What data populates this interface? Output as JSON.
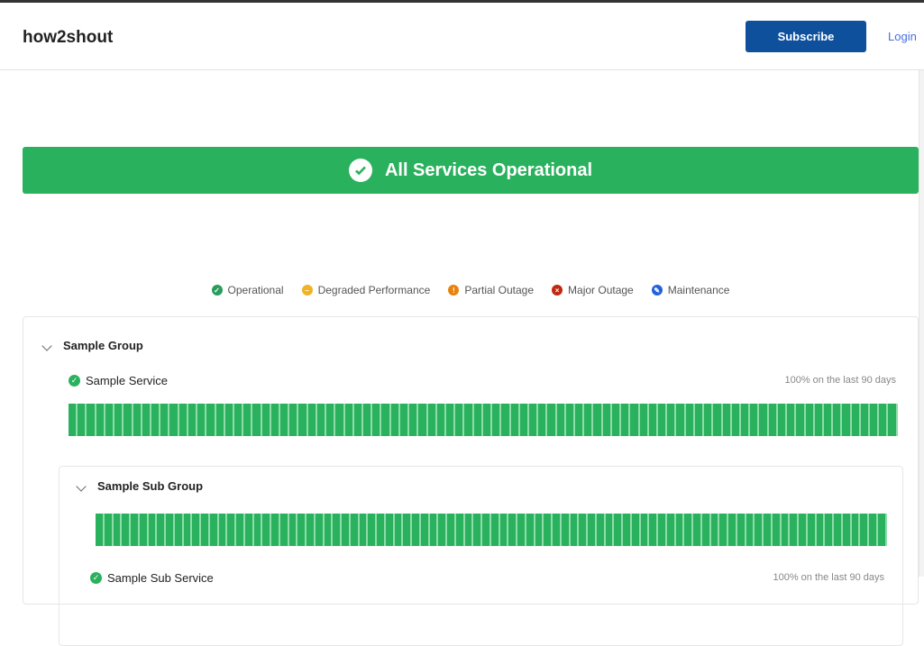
{
  "header": {
    "logo": "how2shout",
    "subscribe": "Subscribe",
    "login": "Login"
  },
  "banner": {
    "text": "All Services Operational",
    "icon": "check-circle-icon"
  },
  "legend": [
    {
      "label": "Operational",
      "color": "#2a9d5c",
      "glyph": "✓"
    },
    {
      "label": "Degraded Performance",
      "color": "#f0b323",
      "glyph": "–"
    },
    {
      "label": "Partial Outage",
      "color": "#e8820c",
      "glyph": "!"
    },
    {
      "label": "Major Outage",
      "color": "#c0290f",
      "glyph": "×"
    },
    {
      "label": "Maintenance",
      "color": "#2461d8",
      "glyph": "✎"
    }
  ],
  "group": {
    "name": "Sample Group",
    "service": {
      "name": "Sample Service",
      "uptime": "100% on the last 90 days",
      "days": 90,
      "status": "operational"
    },
    "subgroup": {
      "name": "Sample Sub Group",
      "days": 90,
      "service": {
        "name": "Sample Sub Service",
        "uptime": "100% on the last 90 days"
      }
    }
  },
  "colors": {
    "operational": "#2ab15d",
    "brand": "#0f509d"
  }
}
